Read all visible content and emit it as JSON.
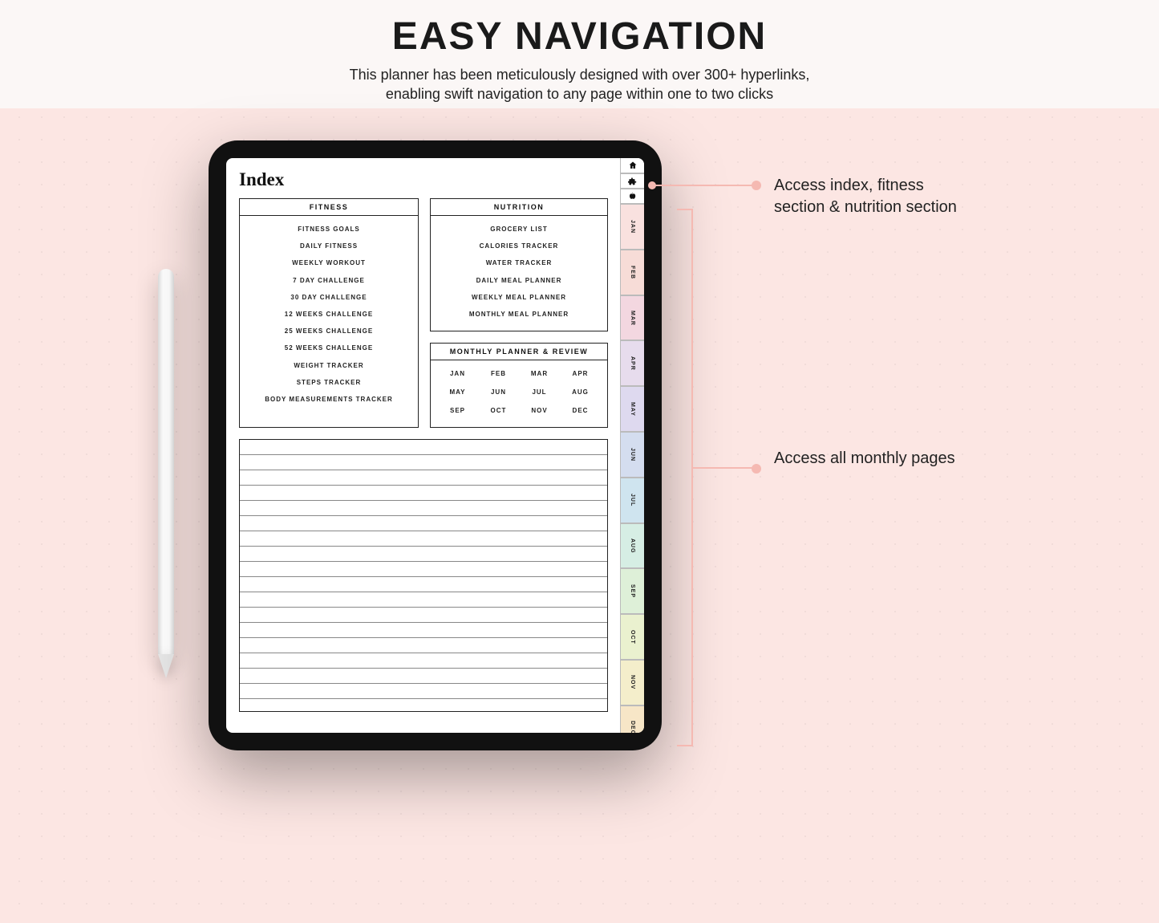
{
  "header": {
    "title": "EASY NAVIGATION",
    "subtitle_line1": "This planner has been meticulously designed with over 300+ hyperlinks,",
    "subtitle_line2": "enabling swift navigation to any page within one to two clicks"
  },
  "planner": {
    "page_title": "Index",
    "fitness": {
      "heading": "FITNESS",
      "items": [
        "FITNESS GOALS",
        "DAILY FITNESS",
        "WEEKLY WORKOUT",
        "7 DAY CHALLENGE",
        "30 DAY CHALLENGE",
        "12 WEEKS CHALLENGE",
        "25 WEEKS CHALLENGE",
        "52 WEEKS CHALLENGE",
        "WEIGHT TRACKER",
        "STEPS TRACKER",
        "BODY MEASUREMENTS TRACKER"
      ]
    },
    "nutrition": {
      "heading": "NUTRITION",
      "items": [
        "GROCERY LIST",
        "CALORIES TRACKER",
        "WATER TRACKER",
        "DAILY MEAL PLANNER",
        "WEEKLY MEAL PLANNER",
        "MONTHLY MEAL PLANNER"
      ]
    },
    "monthly": {
      "heading": "MONTHLY PLANNER & REVIEW",
      "months": [
        "JAN",
        "FEB",
        "MAR",
        "APR",
        "MAY",
        "JUN",
        "JUL",
        "AUG",
        "SEP",
        "OCT",
        "NOV",
        "DEC"
      ]
    },
    "side_tabs": {
      "icons": [
        "home-icon",
        "puzzle-icon",
        "apple-icon"
      ],
      "months": [
        {
          "label": "JAN",
          "color": "#f9e1df"
        },
        {
          "label": "FEB",
          "color": "#f7dcd7"
        },
        {
          "label": "MAR",
          "color": "#f3d7e0"
        },
        {
          "label": "APR",
          "color": "#e7dced"
        },
        {
          "label": "MAY",
          "color": "#ded9ef"
        },
        {
          "label": "JUN",
          "color": "#d4ddef"
        },
        {
          "label": "JUL",
          "color": "#cfe4ef"
        },
        {
          "label": "AUG",
          "color": "#d6eee4"
        },
        {
          "label": "SEP",
          "color": "#def0d8"
        },
        {
          "label": "OCT",
          "color": "#eaf1cf"
        },
        {
          "label": "NOV",
          "color": "#f4eecb"
        },
        {
          "label": "DEC",
          "color": "#f7e6c7"
        }
      ]
    }
  },
  "callouts": {
    "top": "Access index, fitness section & nutrition section",
    "bottom": "Access all monthly pages"
  }
}
